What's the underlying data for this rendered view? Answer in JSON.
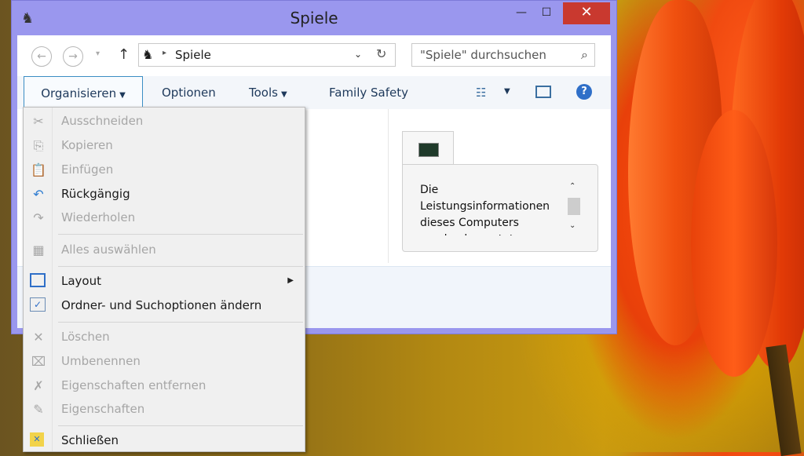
{
  "window": {
    "title": "Spiele",
    "controls": {
      "minimize": "—",
      "maximize": "☐",
      "close": "✕"
    }
  },
  "navigation": {
    "back_icon": "←",
    "forward_icon": "→",
    "recent_icon": "▾",
    "up_icon": "↑",
    "address": {
      "separator": "▸",
      "path": "Spiele",
      "dropdown": "⌄",
      "refresh": "↻"
    },
    "search": {
      "placeholder": "\"Spiele\" durchsuchen",
      "icon": "⌕"
    }
  },
  "commandbar": {
    "organize": "Organisieren",
    "options": "Optionen",
    "tools": "Tools",
    "family_safety": "Family Safety",
    "caret": "▼",
    "help": "?"
  },
  "tile": {
    "text": "Die Leistungsinformationen dieses Computers werden bewertet..."
  },
  "scroll": {
    "up": "⌃",
    "down": "⌄"
  },
  "menu": {
    "items": [
      {
        "label": "Ausschneiden",
        "icon": "✂",
        "enabled": false
      },
      {
        "label": "Kopieren",
        "icon": "⎘",
        "enabled": false
      },
      {
        "label": "Einfügen",
        "icon": "📋",
        "enabled": false
      },
      {
        "label": "Rückgängig",
        "icon": "↶",
        "enabled": true
      },
      {
        "label": "Wiederholen",
        "icon": "↷",
        "enabled": false
      },
      {
        "label": "Alles auswählen",
        "icon": "▦",
        "enabled": false
      },
      {
        "label": "Layout",
        "icon": "",
        "enabled": true,
        "submenu": "▶"
      },
      {
        "label": "Ordner- und Suchoptionen ändern",
        "icon": "✓",
        "enabled": true
      },
      {
        "label": "Löschen",
        "icon": "✕",
        "enabled": false
      },
      {
        "label": "Umbenennen",
        "icon": "⌧",
        "enabled": false
      },
      {
        "label": "Eigenschaften entfernen",
        "icon": "✗",
        "enabled": false
      },
      {
        "label": "Eigenschaften",
        "icon": "✎",
        "enabled": false
      },
      {
        "label": "Schließen",
        "icon": "✕",
        "enabled": true
      }
    ]
  },
  "colors": {
    "window_frame": "#9a97ee",
    "close_button": "#c9392f",
    "accent": "#2f6fc8"
  }
}
